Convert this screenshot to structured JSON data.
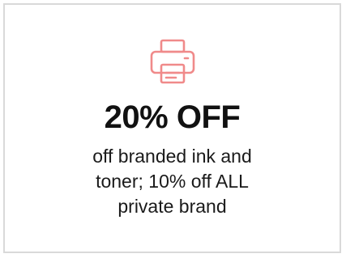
{
  "promo": {
    "icon": "printer-icon",
    "accent_color": "#f08a8a",
    "headline": "20% OFF",
    "description_lines": [
      "off branded ink and",
      "toner; 10% off ALL",
      "private brand"
    ]
  }
}
